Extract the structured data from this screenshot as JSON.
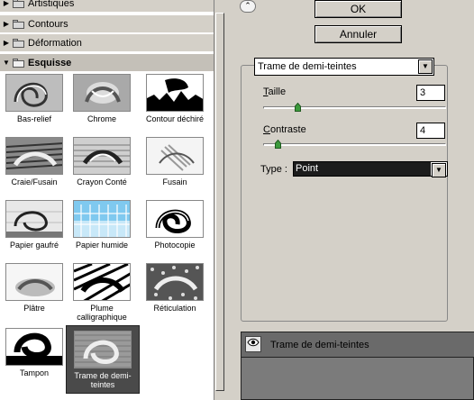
{
  "gallery": {
    "folders": [
      {
        "label": "Artistiques",
        "expanded": false
      },
      {
        "label": "Contours",
        "expanded": false
      },
      {
        "label": "Déformation",
        "expanded": false
      },
      {
        "label": "Esquisse",
        "expanded": true
      }
    ],
    "filters": [
      {
        "label": "Bas-relief"
      },
      {
        "label": "Chrome"
      },
      {
        "label": "Contour déchiré"
      },
      {
        "label": "Craie/Fusain"
      },
      {
        "label": "Crayon Conté"
      },
      {
        "label": "Fusain"
      },
      {
        "label": "Papier gaufré"
      },
      {
        "label": "Papier humide"
      },
      {
        "label": "Photocopie"
      },
      {
        "label": "Plâtre"
      },
      {
        "label": "Plume calligraphique"
      },
      {
        "label": "Réticulation"
      },
      {
        "label": "Tampon"
      },
      {
        "label": "Trame de demi-teintes",
        "selected": true
      }
    ]
  },
  "buttons": {
    "collapse_icon": "chevron-up-double",
    "ok_label": "OK",
    "cancel_label": "Annuler"
  },
  "settings": {
    "filter_name": "Trame de demi-teintes",
    "size_label_mnemonic": "T",
    "size_label_rest": "aille",
    "size_value": "3",
    "contrast_label_mnemonic": "C",
    "contrast_label_rest": "ontraste",
    "contrast_value": "4",
    "type_label": "Type :",
    "type_value": "Point"
  },
  "layers": {
    "item_name": "Trame de demi-teintes",
    "eye_icon": "eye-icon"
  },
  "colors": {
    "selected_thumb_bg": "#4a4a4a",
    "panel_bg": "#d4d0c8",
    "layers_bg": "#7b7b7b"
  }
}
